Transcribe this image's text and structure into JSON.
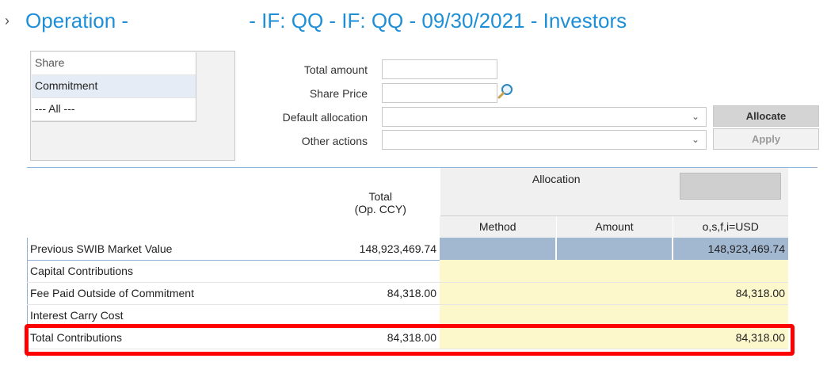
{
  "header": {
    "chevron": "›",
    "title_part1": "Operation - ",
    "title_part2": "- IF: QQ - IF: QQ - 09/30/2021 - Investors"
  },
  "share_list": {
    "header": "Share",
    "items": [
      "Commitment",
      "--- All ---"
    ]
  },
  "form": {
    "total_amount_label": "Total amount",
    "share_price_label": "Share Price",
    "default_allocation_label": "Default allocation",
    "other_actions_label": "Other actions",
    "total_amount_value": "",
    "share_price_value": "",
    "allocate_button": "Allocate",
    "apply_button": "Apply",
    "caret": "⌄"
  },
  "table": {
    "header_total": "Total",
    "header_total_sub": "(Op. CCY)",
    "header_allocation": "Allocation",
    "header_method": "Method",
    "header_amount": "Amount",
    "header_usd": "o,s,f,i=USD",
    "rows": [
      {
        "label": "Previous SWIB Market Value",
        "total": "148,923,469.74",
        "usd": "148,923,469.74"
      },
      {
        "label": "Capital Contributions",
        "total": "",
        "usd": ""
      },
      {
        "label": "Fee Paid Outside of Commitment",
        "total": "84,318.00",
        "usd": "84,318.00"
      },
      {
        "label": "Interest Carry Cost",
        "total": "",
        "usd": ""
      },
      {
        "label": "Total Contributions",
        "total": "84,318.00",
        "usd": "84,318.00"
      }
    ]
  },
  "colors": {
    "title": "#1e8fd6",
    "highlight": "#ff0000",
    "editable_cell": "#fdf7cc",
    "market_value_cell": "#a2b7d0"
  }
}
